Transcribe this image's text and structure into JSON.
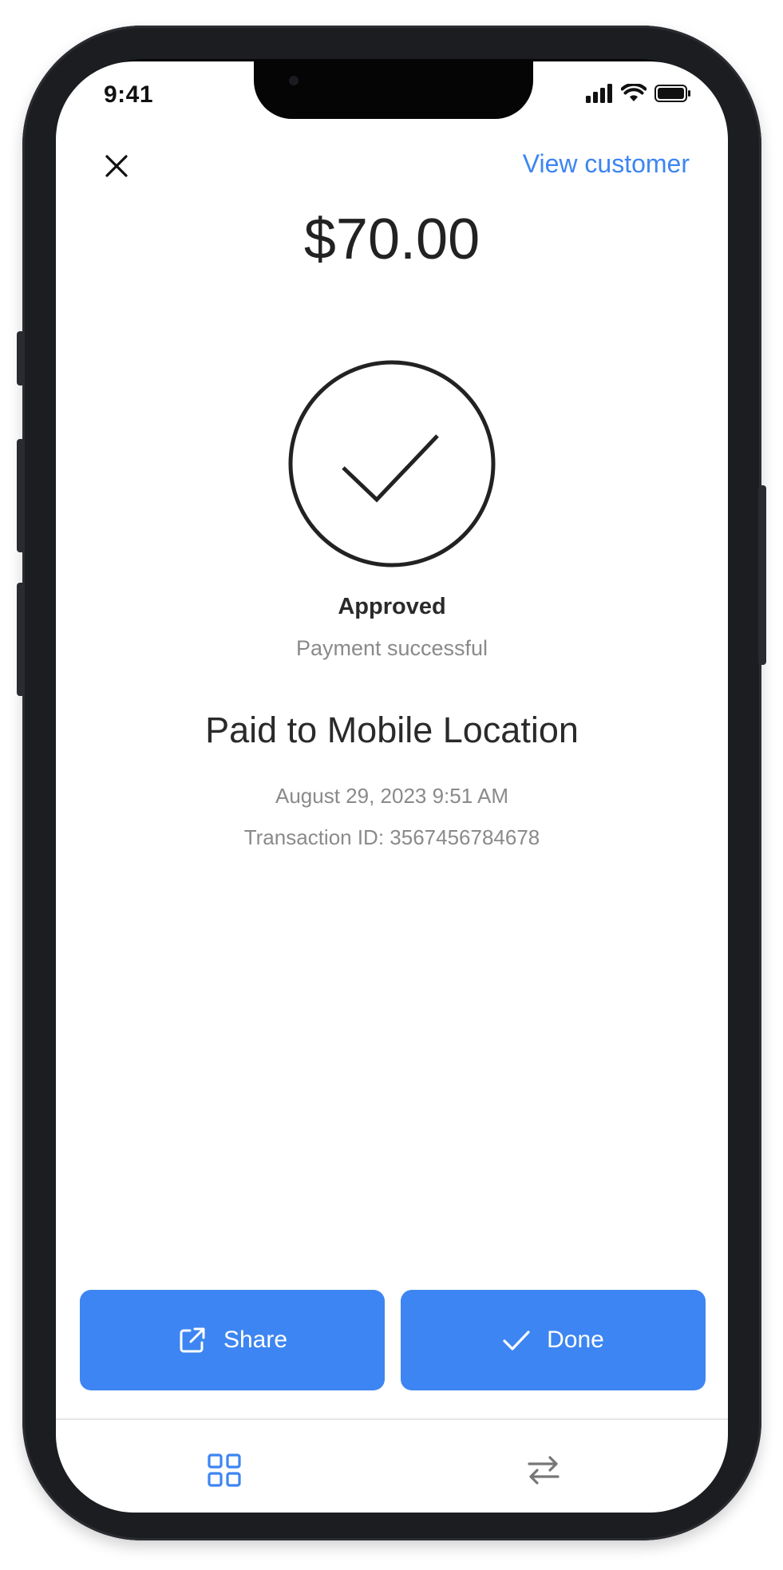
{
  "status_bar": {
    "time": "9:41"
  },
  "header": {
    "view_customer_label": "View customer"
  },
  "payment": {
    "amount": "$70.00",
    "status_title": "Approved",
    "status_subtitle": "Payment successful",
    "paid_to": "Paid to Mobile Location",
    "date": "August 29, 2023 9:51 AM",
    "transaction_id": "Transaction ID: 3567456784678"
  },
  "actions": {
    "share_label": "Share",
    "done_label": "Done"
  },
  "icons": {
    "close": "close-icon",
    "approved": "checkmark-circle-icon",
    "share": "external-link-icon",
    "done": "checkmark-icon",
    "tab_grid": "grid-icon",
    "tab_transfer": "transfer-arrows-icon"
  },
  "colors": {
    "accent": "#3d85f2",
    "text_primary": "#222222",
    "text_secondary": "#8a8a8a"
  }
}
